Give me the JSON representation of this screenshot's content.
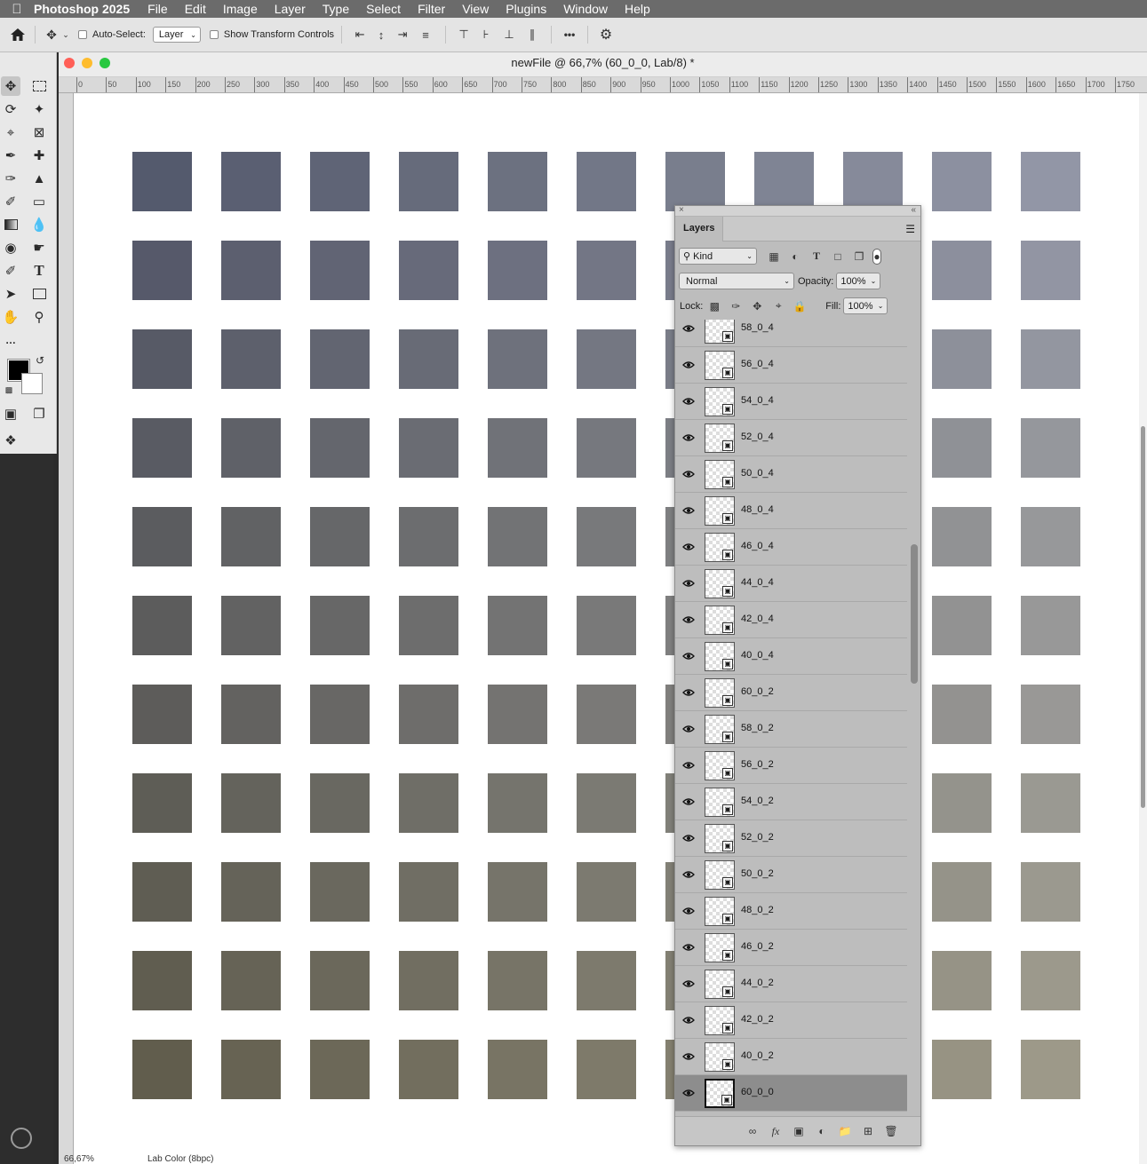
{
  "menubar": {
    "app_name": "Photoshop 2025",
    "items": [
      "File",
      "Edit",
      "Image",
      "Layer",
      "Type",
      "Select",
      "Filter",
      "View",
      "Plugins",
      "Window",
      "Help"
    ]
  },
  "optionsbar": {
    "auto_select_label": "Auto-Select:",
    "auto_select_value": "Layer",
    "show_transform_label": "Show Transform Controls",
    "more_label": "•••"
  },
  "document": {
    "title": "newFile @ 66,7% (60_0_0, Lab/8) *",
    "ruler_labels": [
      "0",
      "50",
      "100",
      "150",
      "200",
      "250",
      "300",
      "350",
      "400",
      "450",
      "500",
      "550",
      "600",
      "650",
      "700",
      "750",
      "800",
      "850",
      "900",
      "950",
      "1000",
      "1050",
      "1100",
      "1150",
      "1200",
      "1250",
      "1300",
      "1350",
      "1400",
      "1450",
      "1500",
      "1550",
      "1600",
      "1650",
      "1700",
      "1750"
    ],
    "status_zoom": "66,67%",
    "status_profile": "Lab Color (8bpc)"
  },
  "swatches": [
    [
      "#545a6d",
      "#5a5f72",
      "#5f6476",
      "#666b7b",
      "#6c7180",
      "#727787",
      "#797e8d",
      "#7f8494",
      "#868a9a",
      "#8c90a0",
      "#9296a6"
    ],
    [
      "#56596a",
      "#5c5f6f",
      "#616474",
      "#676a7a",
      "#6d7080",
      "#737685",
      "#797c8b",
      "#808391",
      "#868997",
      "#8c8f9d",
      "#9295a3"
    ],
    [
      "#575a66",
      "#5d606c",
      "#626571",
      "#686b76",
      "#6e717c",
      "#747782",
      "#7a7d88",
      "#81848e",
      "#878a94",
      "#8d909a",
      "#9396a0"
    ],
    [
      "#595b63",
      "#5f6168",
      "#64666d",
      "#6a6c73",
      "#707278",
      "#76787e",
      "#7c7e84",
      "#83858a",
      "#898b90",
      "#8f9196",
      "#95979c"
    ],
    [
      "#5b5c5f",
      "#616264",
      "#666769",
      "#6c6d6f",
      "#727375",
      "#78797b",
      "#7e7f81",
      "#858688",
      "#8b8c8e",
      "#919294",
      "#97989a"
    ],
    [
      "#5c5c5c",
      "#626262",
      "#676767",
      "#6d6d6d",
      "#737373",
      "#797979",
      "#7f7f7f",
      "#868686",
      "#8c8c8c",
      "#929292",
      "#989898"
    ],
    [
      "#5d5c5a",
      "#636260",
      "#686765",
      "#6e6d6b",
      "#747371",
      "#7a7977",
      "#807f7d",
      "#878684",
      "#8d8c8a",
      "#939290",
      "#999896"
    ],
    [
      "#5e5d56",
      "#64635c",
      "#696861",
      "#6f6e67",
      "#75746d",
      "#7b7a73",
      "#818079",
      "#888780",
      "#8e8d86",
      "#94938c",
      "#9a9992"
    ],
    [
      "#5f5d53",
      "#656359",
      "#6a685e",
      "#706e64",
      "#76746a",
      "#7c7a70",
      "#828076",
      "#89877d",
      "#8f8d83",
      "#959389",
      "#9b998f"
    ],
    [
      "#605d50",
      "#666356",
      "#6b685b",
      "#716e61",
      "#777467",
      "#7d7a6d",
      "#838073",
      "#8a877a",
      "#908d80",
      "#969386",
      "#9c998c"
    ],
    [
      "#615d4d",
      "#676353",
      "#6c6858",
      "#726e5e",
      "#787464",
      "#7e7a6a",
      "#848070",
      "#8b8777",
      "#918d7d",
      "#979383",
      "#9d9989"
    ]
  ],
  "layers_panel": {
    "tab_label": "Layers",
    "filter_kind": "Kind",
    "blend_mode": "Normal",
    "opacity_label": "Opacity:",
    "opacity_value": "100%",
    "lock_label": "Lock:",
    "fill_label": "Fill:",
    "fill_value": "100%",
    "layers": [
      {
        "name": "58_0_4"
      },
      {
        "name": "56_0_4"
      },
      {
        "name": "54_0_4"
      },
      {
        "name": "52_0_4"
      },
      {
        "name": "50_0_4"
      },
      {
        "name": "48_0_4"
      },
      {
        "name": "46_0_4"
      },
      {
        "name": "44_0_4"
      },
      {
        "name": "42_0_4"
      },
      {
        "name": "40_0_4"
      },
      {
        "name": "60_0_2"
      },
      {
        "name": "58_0_2"
      },
      {
        "name": "56_0_2"
      },
      {
        "name": "54_0_2"
      },
      {
        "name": "52_0_2"
      },
      {
        "name": "50_0_2"
      },
      {
        "name": "48_0_2"
      },
      {
        "name": "46_0_2"
      },
      {
        "name": "44_0_2"
      },
      {
        "name": "42_0_2"
      },
      {
        "name": "40_0_2"
      },
      {
        "name": "60_0_0",
        "selected": true
      }
    ]
  }
}
